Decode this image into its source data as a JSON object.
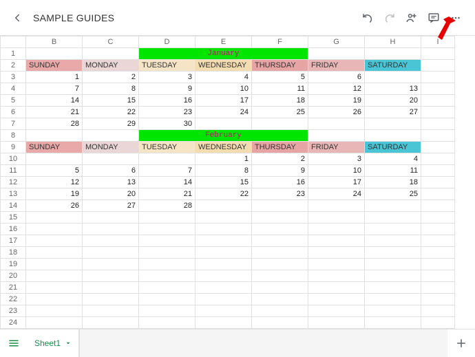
{
  "header": {
    "title": "SAMPLE GUIDES"
  },
  "columns": [
    "B",
    "C",
    "D",
    "E",
    "F",
    "G",
    "H",
    "I"
  ],
  "months": {
    "jan": "January",
    "feb": "February"
  },
  "days": {
    "sun": "SUNDAY",
    "mon": "MONDAY",
    "tue": "TUESDAY",
    "wed": "WEDNESDAY",
    "thu": "THURSDAY",
    "fri": "FRIDAY",
    "sat": "SATURDAY"
  },
  "rows": [
    {
      "n": "1"
    },
    {
      "n": "2"
    },
    {
      "n": "3"
    },
    {
      "n": "4"
    },
    {
      "n": "5"
    },
    {
      "n": "6"
    },
    {
      "n": "7"
    },
    {
      "n": "8"
    },
    {
      "n": "9"
    },
    {
      "n": "10"
    },
    {
      "n": "11"
    },
    {
      "n": "12"
    },
    {
      "n": "13"
    },
    {
      "n": "14"
    },
    {
      "n": "15"
    },
    {
      "n": "16"
    },
    {
      "n": "17"
    },
    {
      "n": "18"
    },
    {
      "n": "19"
    },
    {
      "n": "20"
    },
    {
      "n": "21"
    },
    {
      "n": "22"
    },
    {
      "n": "23"
    },
    {
      "n": "24"
    }
  ],
  "jan_data": [
    [
      "",
      "",
      "",
      "",
      "",
      "1",
      "2"
    ],
    [
      "",
      "",
      "",
      "",
      "",
      "",
      ""
    ],
    [
      "7",
      "8",
      "9",
      "10",
      "11",
      "12",
      "13"
    ],
    [
      "14",
      "15",
      "16",
      "17",
      "18",
      "19",
      "20"
    ],
    [
      "21",
      "22",
      "23",
      "24",
      "25",
      "26",
      "27"
    ],
    [
      "28",
      "29",
      "30",
      "",
      "",
      "",
      ""
    ]
  ],
  "jan_row3": {
    "b": "1",
    "c": "2",
    "d": "3",
    "e": "4",
    "f": "5",
    "g": "6"
  },
  "feb_data": [
    [
      "",
      "",
      "",
      "1",
      "2",
      "3",
      "4"
    ],
    [
      "5",
      "6",
      "7",
      "8",
      "9",
      "10",
      "11"
    ],
    [
      "12",
      "13",
      "14",
      "15",
      "16",
      "17",
      "18"
    ],
    [
      "19",
      "20",
      "21",
      "22",
      "23",
      "24",
      "25"
    ],
    [
      "26",
      "27",
      "28",
      "",
      "",
      "",
      ""
    ]
  ],
  "footer": {
    "sheet_name": "Sheet1"
  }
}
